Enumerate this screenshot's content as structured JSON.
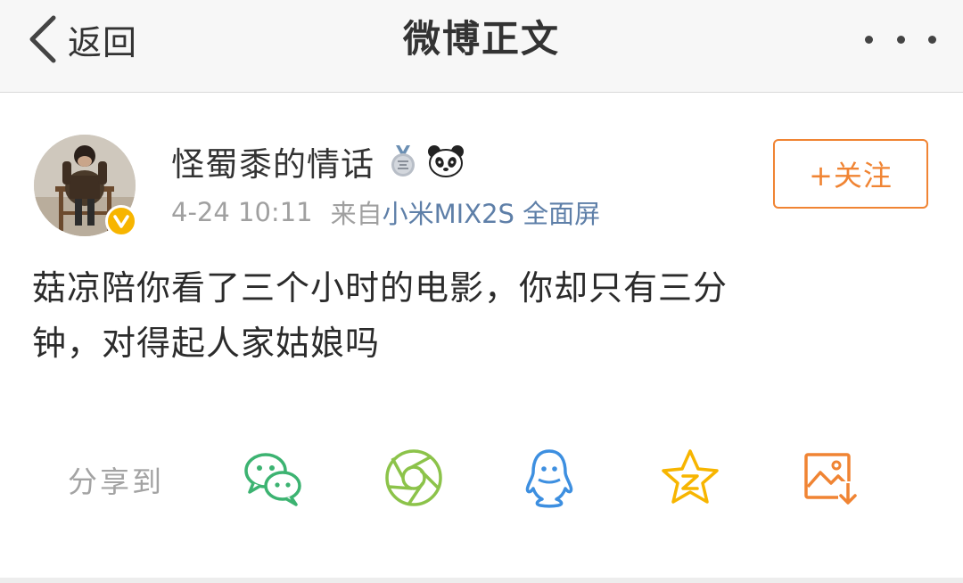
{
  "navbar": {
    "back_label": "返回",
    "title": "微博正文",
    "back_icon": "chevron-left-icon",
    "more_icon": "more-dots-icon"
  },
  "post": {
    "username": "怪蜀黍的情话",
    "time": "4-24 10:11",
    "from_label": "来自",
    "device": "小米MIX2S 全面屏",
    "follow_label": "+关注",
    "text_line1": "菇凉陪你看了三个小时的电影，你却只有三分",
    "text_line2": "钟，对得起人家姑娘吗",
    "badges": [
      "medal-icon",
      "panda-icon"
    ],
    "verified_icon": "verified-v-icon"
  },
  "share": {
    "label": "分享到",
    "targets": [
      {
        "name": "wechat-icon",
        "color": "#3cb371"
      },
      {
        "name": "moments-icon",
        "color": "#8cc34a"
      },
      {
        "name": "qq-icon",
        "color": "#3d8fe0"
      },
      {
        "name": "qzone-icon",
        "color": "#f7b500"
      },
      {
        "name": "save-image-icon",
        "color": "#f08433"
      }
    ]
  },
  "colors": {
    "accent": "#f08433",
    "link": "#5e7fa8",
    "verified": "#f7b500",
    "meta_text": "#a0a0a0"
  }
}
